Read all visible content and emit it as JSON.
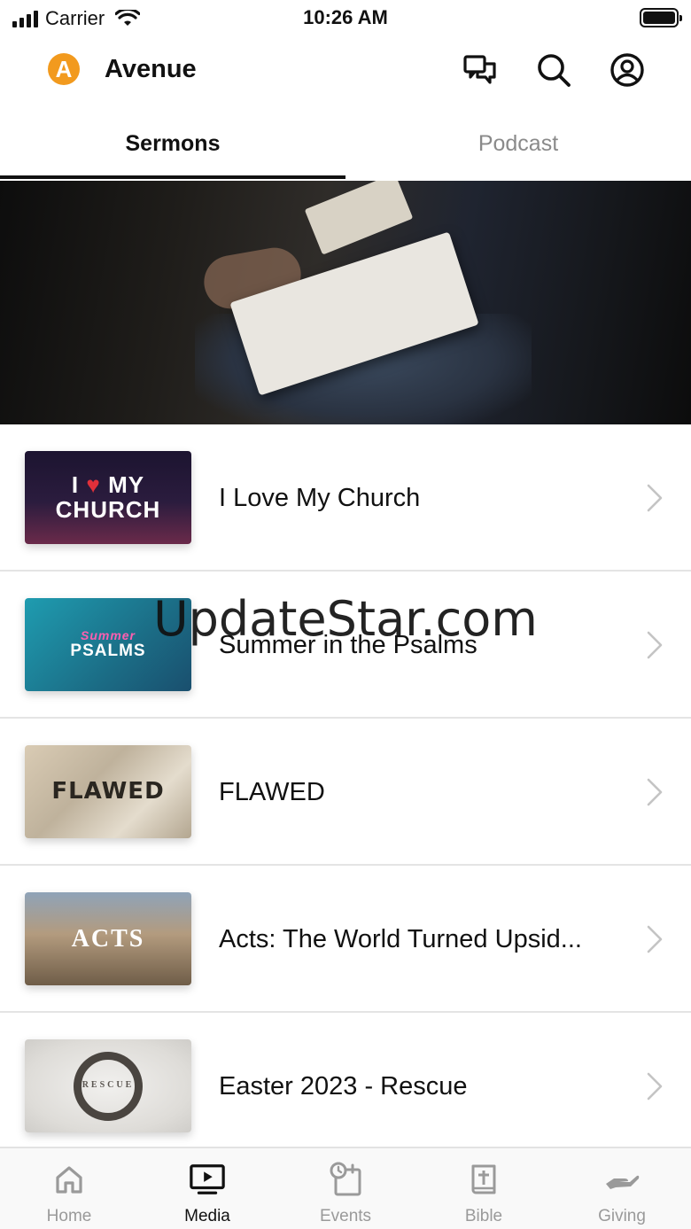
{
  "status_bar": {
    "carrier": "Carrier",
    "time": "10:26 AM"
  },
  "header": {
    "logo_letter": "A",
    "title": "Avenue",
    "icons": [
      "chat-icon",
      "search-icon",
      "account-icon"
    ]
  },
  "tabs": [
    {
      "label": "Sermons",
      "active": true
    },
    {
      "label": "Podcast",
      "active": false
    }
  ],
  "sermons": [
    {
      "title": "I Love My Church",
      "thumb": {
        "line1": "I",
        "heart": "♥",
        "line1b": "MY",
        "line2": "CHURCH"
      }
    },
    {
      "title": "Summer in the Psalms",
      "thumb": {
        "script": "Summer",
        "main": "PSALMS"
      }
    },
    {
      "title": "FLAWED",
      "thumb": {
        "main": "FLAWED"
      }
    },
    {
      "title": "Acts: The World Turned Upsid...",
      "thumb": {
        "main": "ACTS"
      }
    },
    {
      "title": "Easter 2023 - Rescue",
      "thumb": {
        "main": "RESCUE"
      }
    }
  ],
  "watermark": "UpdateStar.com",
  "bottom_nav": [
    {
      "label": "Home",
      "icon": "home-icon",
      "active": false
    },
    {
      "label": "Media",
      "icon": "media-icon",
      "active": true
    },
    {
      "label": "Events",
      "icon": "events-icon",
      "active": false
    },
    {
      "label": "Bible",
      "icon": "bible-icon",
      "active": false
    },
    {
      "label": "Giving",
      "icon": "giving-icon",
      "active": false
    }
  ],
  "colors": {
    "brand": "#f29a1e",
    "active_text": "#111111",
    "inactive_text": "#8a8a8a"
  }
}
